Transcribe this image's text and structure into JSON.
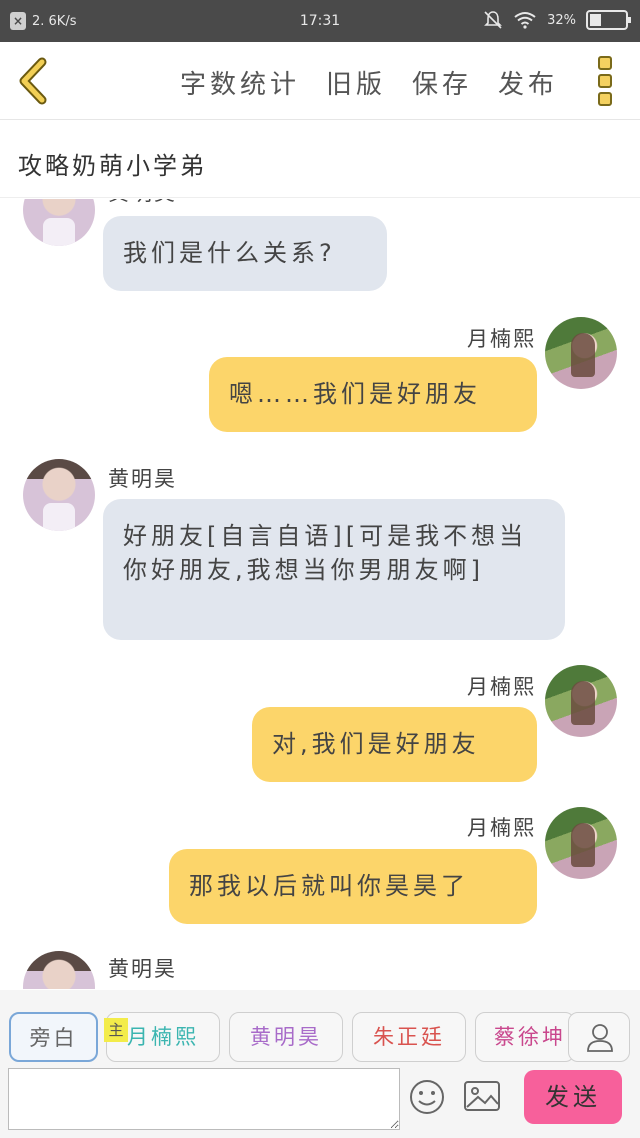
{
  "status_bar": {
    "speed": "2. 6K/s",
    "time": "17:31",
    "battery": "32%",
    "battery_level": 0.32
  },
  "toolbar": {
    "actions": [
      "字数统计",
      "旧版",
      "保存",
      "发布"
    ]
  },
  "story": {
    "title": "攻略奶萌小学弟"
  },
  "messages": [
    {
      "side": "left",
      "speaker": "黄明昊",
      "text": "我们是什么关系?"
    },
    {
      "side": "right",
      "speaker": "月楠熙",
      "text": "嗯……我们是好朋友"
    },
    {
      "side": "left",
      "speaker": "黄明昊",
      "text": "好朋友[自言自语][可是我不想当你好朋友,我想当你男朋友啊]"
    },
    {
      "side": "right",
      "speaker": "月楠熙",
      "text": "对,我们是好朋友"
    },
    {
      "side": "right",
      "speaker": "月楠熙",
      "text": "那我以后就叫你昊昊了"
    },
    {
      "side": "left",
      "speaker": "黄明昊",
      "text": ""
    }
  ],
  "roles": {
    "main_tag": "主",
    "items": [
      {
        "label": "旁白",
        "color": "#666666"
      },
      {
        "label": "月楠熙",
        "color": "#3bb5b0"
      },
      {
        "label": "黄明昊",
        "color": "#a86bc9"
      },
      {
        "label": "朱正廷",
        "color": "#d9534f"
      },
      {
        "label": "蔡徐坤",
        "color": "#c9478d"
      }
    ]
  },
  "input": {
    "value": "",
    "send_label": "发送"
  },
  "icons": [
    "back-icon",
    "more-icon",
    "user-icon",
    "emoji-icon",
    "image-icon"
  ]
}
